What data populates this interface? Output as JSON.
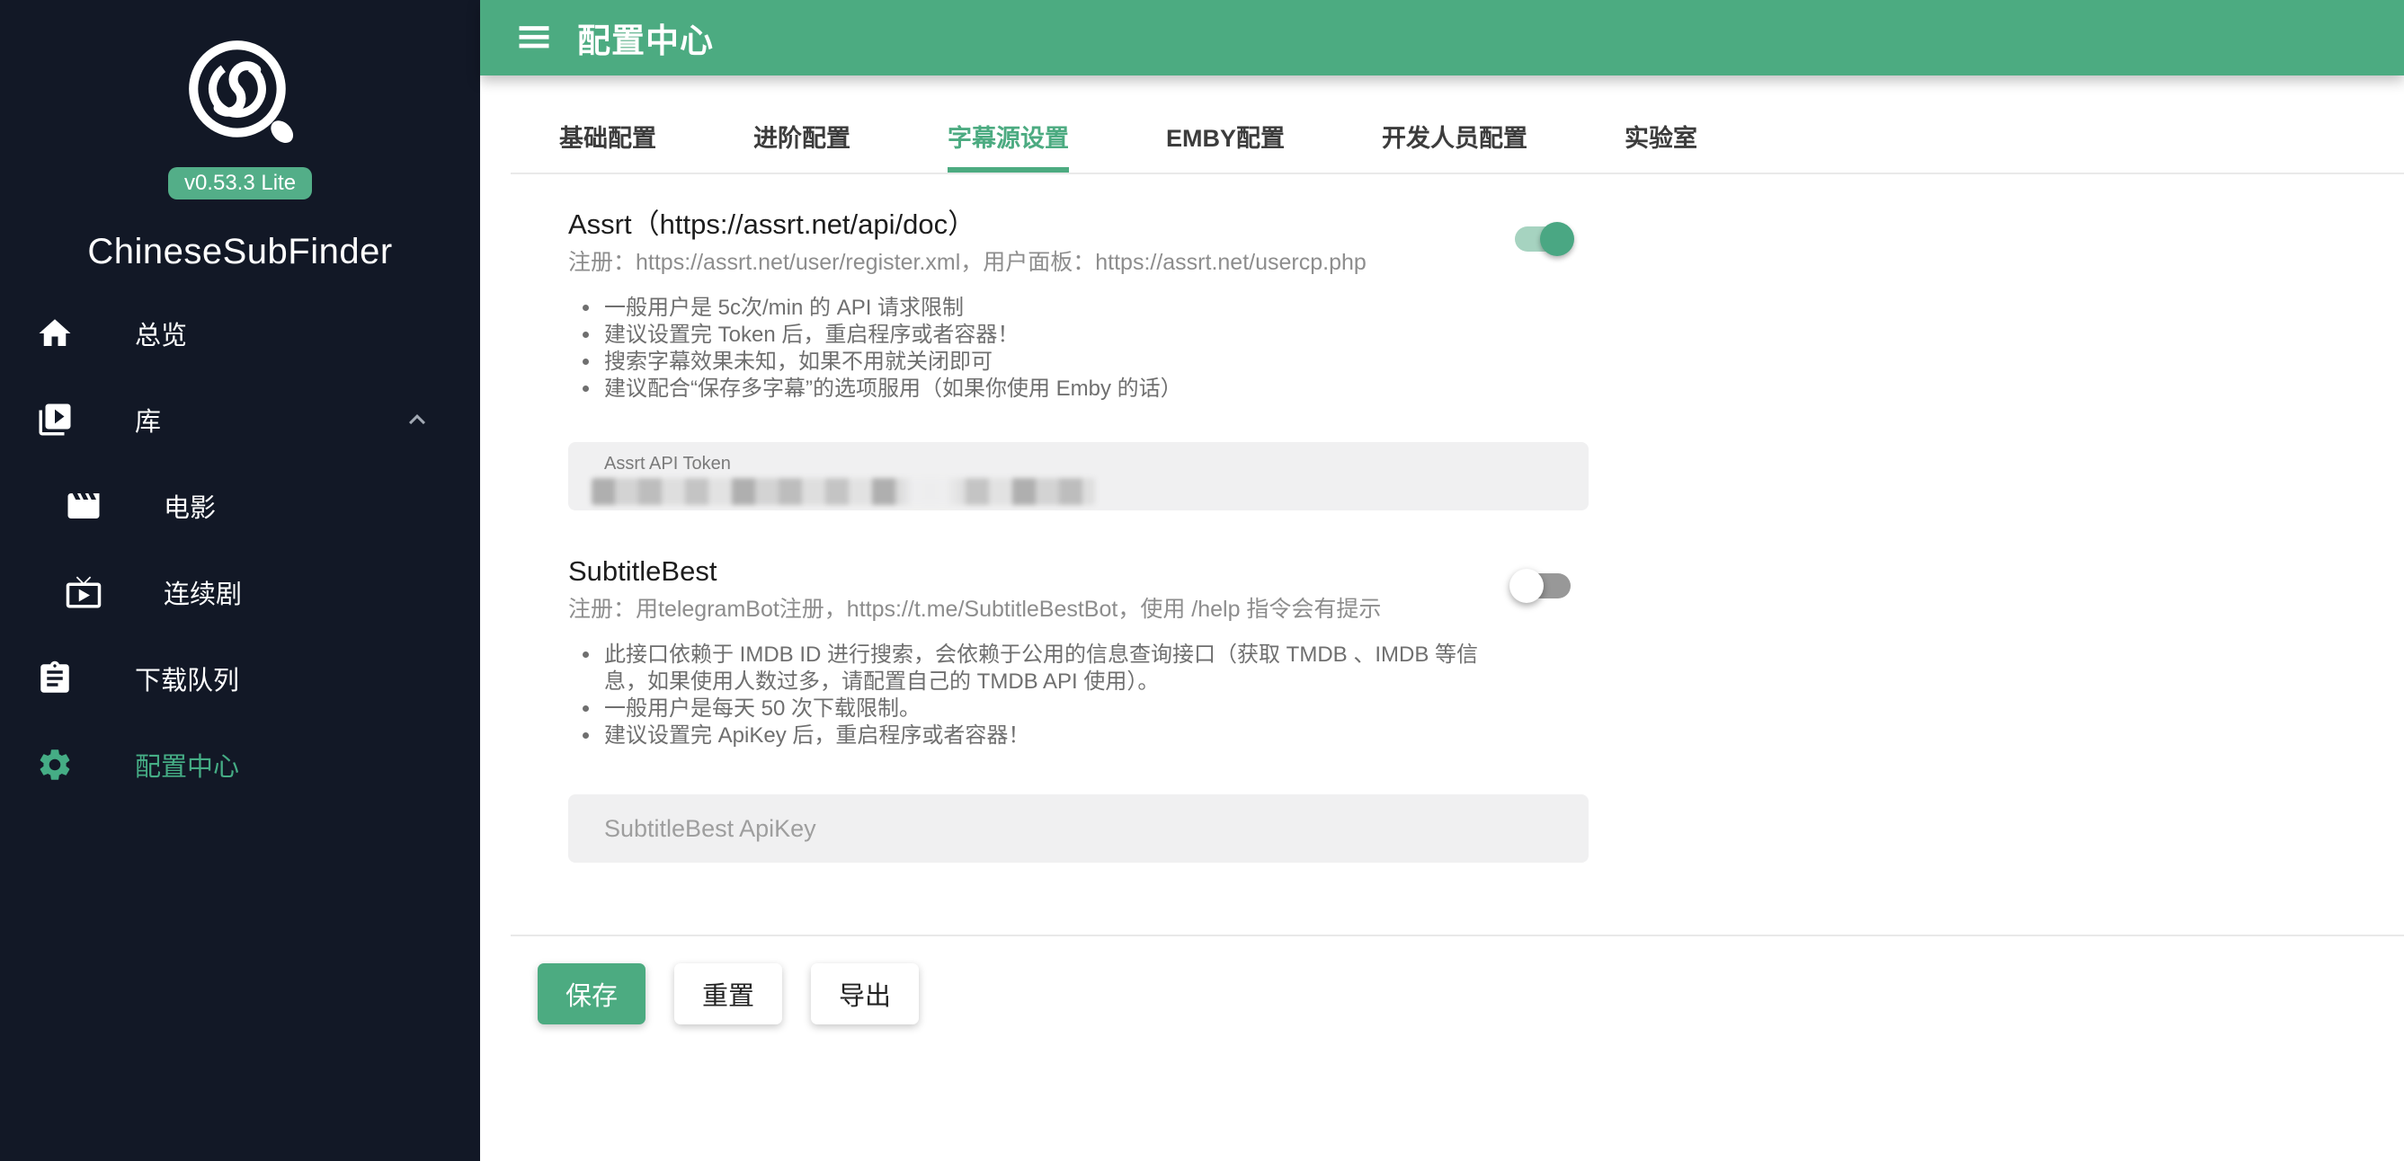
{
  "colors": {
    "primary_green": "#4cab81",
    "sidebar_bg": "#121826",
    "toggle_on_track": "#a6d3c0",
    "toggle_on_thumb": "#4aa783",
    "toggle_off_track": "#989898"
  },
  "sidebar": {
    "version_badge": "v0.53.3 Lite",
    "app_name": "ChineseSubFinder",
    "items": [
      {
        "label": "总览",
        "icon": "home"
      },
      {
        "label": "库",
        "icon": "video-library",
        "expanded": true
      },
      {
        "label": "电影",
        "icon": "movie",
        "child": true
      },
      {
        "label": "连续剧",
        "icon": "live-tv",
        "child": true
      },
      {
        "label": "下载队列",
        "icon": "assignment"
      },
      {
        "label": "配置中心",
        "icon": "settings",
        "active": true
      }
    ]
  },
  "appbar": {
    "title": "配置中心"
  },
  "tabs": [
    {
      "label": "基础配置",
      "active": false
    },
    {
      "label": "进阶配置",
      "active": false
    },
    {
      "label": "字幕源设置",
      "active": true
    },
    {
      "label": "EMBY配置",
      "active": false
    },
    {
      "label": "开发人员配置",
      "active": false
    },
    {
      "label": "实验室",
      "active": false
    }
  ],
  "sections": {
    "assrt": {
      "title": "Assrt（https://assrt.net/api/doc）",
      "subtitle": "注册：https://assrt.net/user/register.xml，用户面板：https://assrt.net/usercp.php",
      "enabled": true,
      "bullets": [
        "一般用户是 5c次/min 的 API 请求限制",
        "建议设置完 Token 后，重启程序或者容器！",
        "搜索字幕效果未知，如果不用就关闭即可",
        "建议配合“保存多字幕”的选项服用（如果你使用 Emby 的话）"
      ],
      "field_label": "Assrt API Token",
      "field_value_masked": true
    },
    "subtitlebest": {
      "title": "SubtitleBest",
      "subtitle": "注册：用telegramBot注册，https://t.me/SubtitleBestBot，使用 /help 指令会有提示",
      "enabled": false,
      "bullets": [
        "此接口依赖于 IMDB ID 进行搜索，会依赖于公用的信息查询接口（获取 TMDB 、IMDB 等信息，如果使用人数过多，请配置自己的 TMDB API 使用）。",
        "一般用户是每天 50 次下载限制。",
        "建议设置完 ApiKey 后，重启程序或者容器！"
      ],
      "field_placeholder": "SubtitleBest ApiKey"
    }
  },
  "actions": {
    "save": "保存",
    "reset": "重置",
    "export": "导出"
  }
}
